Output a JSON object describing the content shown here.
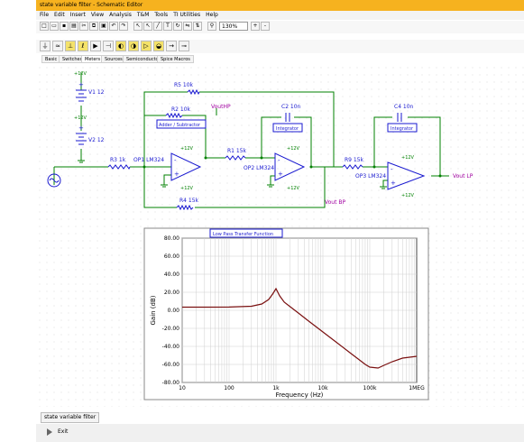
{
  "window": {
    "title": "state variable filter - Schematic Editor"
  },
  "menu": [
    "File",
    "Edit",
    "Insert",
    "View",
    "Analysis",
    "T&M",
    "Tools",
    "TI Utilities",
    "Help"
  ],
  "toolbar": {
    "zoom_value": "130%"
  },
  "tabs": [
    "Basic",
    "Switches",
    "Meters",
    "Sources",
    "Semiconductors",
    "Spice Macros"
  ],
  "schematic": {
    "sources": {
      "v1": "V1 12",
      "v2": "V2 12",
      "plus": "+",
      "v_label": "+12V"
    },
    "resistors": {
      "r5": "R5 10k",
      "r2": "R2 10k",
      "r3": "R3 1k",
      "r1": "R1 15k",
      "r4": "R4 15k",
      "r9": "R9 15k"
    },
    "capacitors": {
      "c2": "C2 10n",
      "c4": "C4 10n"
    },
    "opamps": {
      "op1": "OP1 LM324",
      "op2": "OP2 LM324",
      "op3": "OP3 LM324",
      "minus": "-",
      "plus": "+",
      "v_pos": "+12V",
      "v_neg": "+12V"
    },
    "boxes": {
      "adder": "Adder / Subtractor",
      "int1": "Integrator",
      "int2": "Integrator"
    },
    "outputs": {
      "hp": "VoutHP",
      "bp": "Vout BP",
      "lp": "Vout LP"
    }
  },
  "chart_data": {
    "type": "line",
    "title": "Low Pass Transfer Function",
    "xlabel": "Frequency (Hz)",
    "ylabel": "Gain (dB)",
    "x_scale": "log",
    "xlim": [
      10,
      1000000
    ],
    "ylim": [
      -80,
      80
    ],
    "x_ticks": [
      "10",
      "100",
      "1k",
      "10k",
      "100k",
      "1MEG"
    ],
    "y_ticks": [
      "80.00",
      "60.00",
      "40.00",
      "20.00",
      "0.00",
      "-20.00",
      "-40.00",
      "-60.00",
      "-80.00"
    ],
    "grid": true,
    "line_color": "#7a1010",
    "x": [
      10,
      30,
      100,
      300,
      500,
      700,
      850,
      1000,
      1200,
      1500,
      2000,
      3000,
      5000,
      10000,
      20000,
      40000,
      60000,
      80000,
      100000,
      150000,
      200000,
      300000,
      500000,
      1000000
    ],
    "y": [
      3.5,
      3.5,
      3.6,
      4.5,
      7,
      12,
      18,
      24,
      16,
      9,
      4,
      -3,
      -12,
      -24,
      -36,
      -48,
      -55,
      -60,
      -63,
      -64,
      -61,
      -57,
      -53,
      -51
    ]
  },
  "document_tab": "state variable filter",
  "status": {
    "exit": "Exit"
  },
  "colors": {
    "titlebar": "#f6b21f",
    "wire": "#008000",
    "label_blue": "#1a1ad0",
    "output_purple": "#a000a0",
    "curve": "#7a1010"
  }
}
